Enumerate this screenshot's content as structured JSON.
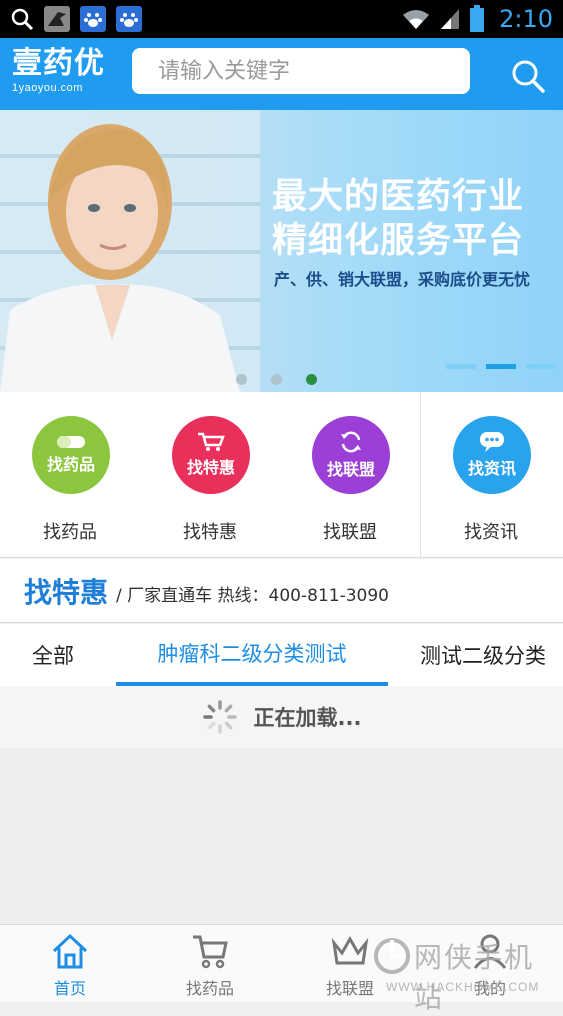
{
  "status_bar": {
    "time": "2:10",
    "icons": [
      "search-icon",
      "bird-icon",
      "baidu-icon",
      "baidu-icon",
      "wifi-icon",
      "signal-icon",
      "battery-icon"
    ]
  },
  "header": {
    "logo_text": "壹药优",
    "logo_sub": "1yaoyou.com",
    "search_placeholder": "请输入关键字",
    "search_icon": "search-icon",
    "background": "#1f9cf0"
  },
  "banner": {
    "title_line1": "最大的医药行业",
    "title_line2": "精细化服务平台",
    "subtitle": "产、供、销大联盟，采购底价更无忧",
    "active_dot": 2,
    "active_bar": 1
  },
  "quick_links": [
    {
      "circle_label": "找药品",
      "label": "找药品",
      "color": "#8cc63e",
      "icon": "pill-icon"
    },
    {
      "circle_label": "找特惠",
      "label": "找特惠",
      "color": "#e8305a",
      "icon": "cart-icon"
    },
    {
      "circle_label": "找联盟",
      "label": "找联盟",
      "color": "#9b3fd6",
      "icon": "refresh-icon"
    },
    {
      "circle_label": "找资讯",
      "label": "找资讯",
      "color": "#2aa3ee",
      "icon": "chat-icon"
    }
  ],
  "deals": {
    "title": "找特惠",
    "subtitle": "/ 厂家直通车  热线：400-811-3090"
  },
  "tabs": [
    {
      "label": "全部",
      "active": false
    },
    {
      "label": "肿瘤科二级分类测试",
      "active": true
    },
    {
      "label": "测试二级分类",
      "active": false
    }
  ],
  "loading_text": "正在加载...",
  "bottom_nav": [
    {
      "label": "首页",
      "icon": "home-icon",
      "active": true
    },
    {
      "label": "找药品",
      "icon": "cart-icon",
      "active": false
    },
    {
      "label": "找联盟",
      "icon": "crown-icon",
      "active": false
    },
    {
      "label": "我的",
      "icon": "person-icon",
      "active": false
    }
  ],
  "watermark": {
    "main": "网侠手机站",
    "sub": "WWW.HACKHOME.COM"
  }
}
